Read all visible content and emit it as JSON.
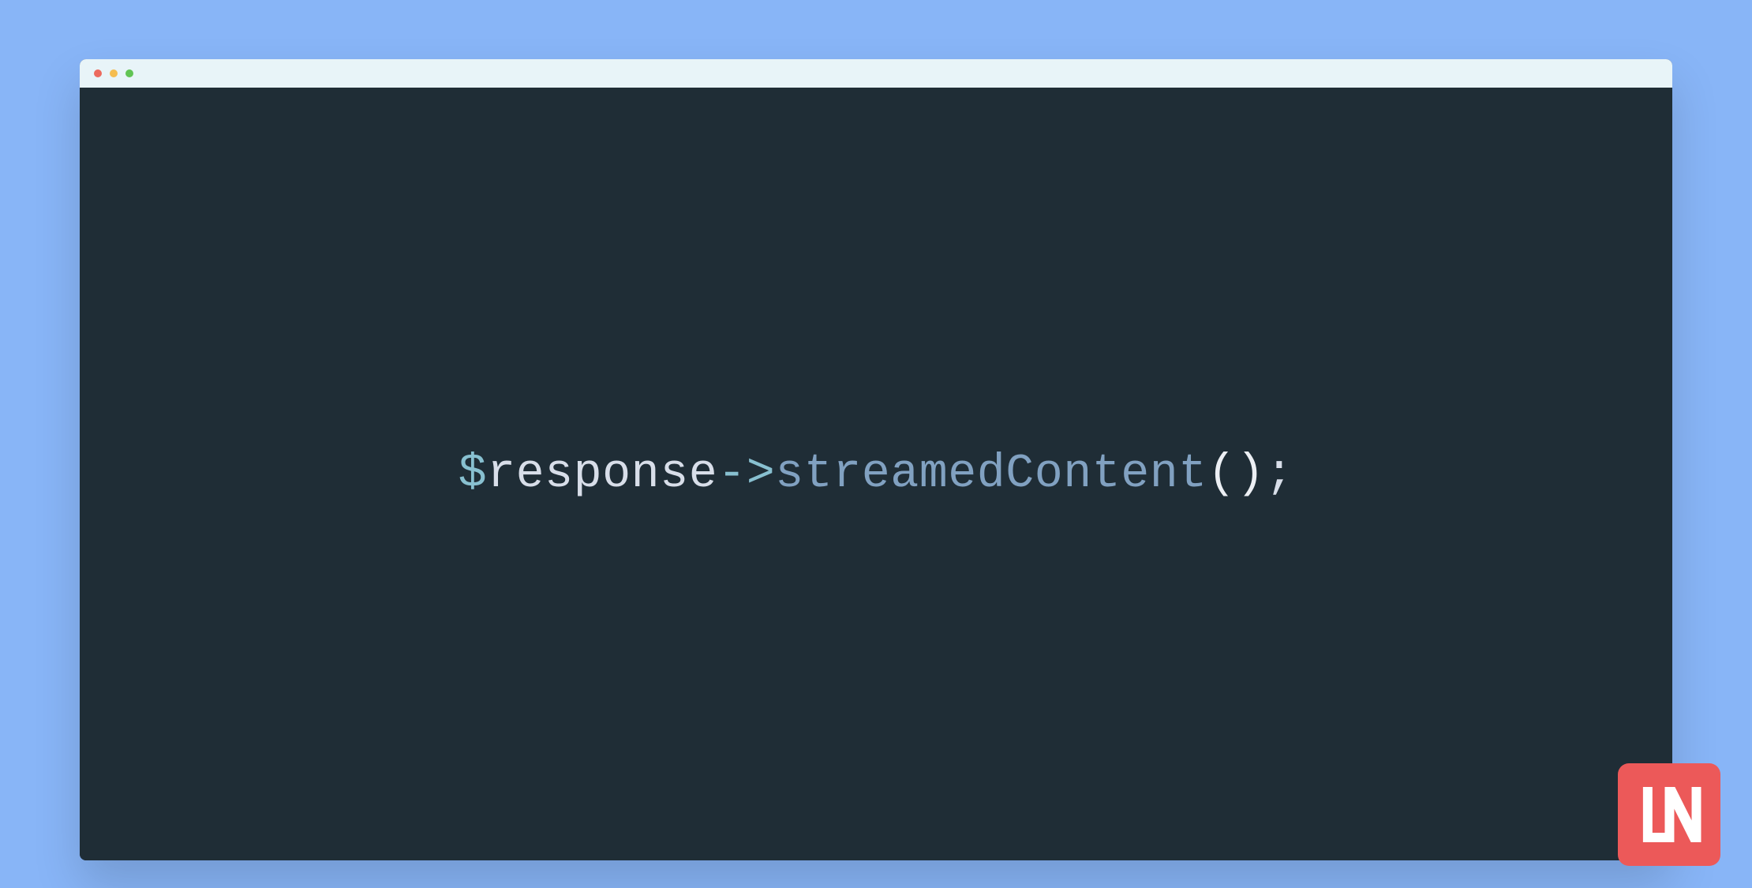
{
  "code": {
    "dollar": "$",
    "variable": "response",
    "arrow": "->",
    "method": "streamedContent",
    "open_paren": "(",
    "close_paren": ")",
    "semicolon": ";"
  },
  "logo": {
    "text": "LN"
  },
  "colors": {
    "background": "#88b5f7",
    "editor_bg": "#1f2d36",
    "titlebar_bg": "#e8f4f8",
    "logo_bg": "#ec5959",
    "traffic_red": "#ec6a5e",
    "traffic_yellow": "#f5bd4f",
    "traffic_green": "#61c454"
  }
}
